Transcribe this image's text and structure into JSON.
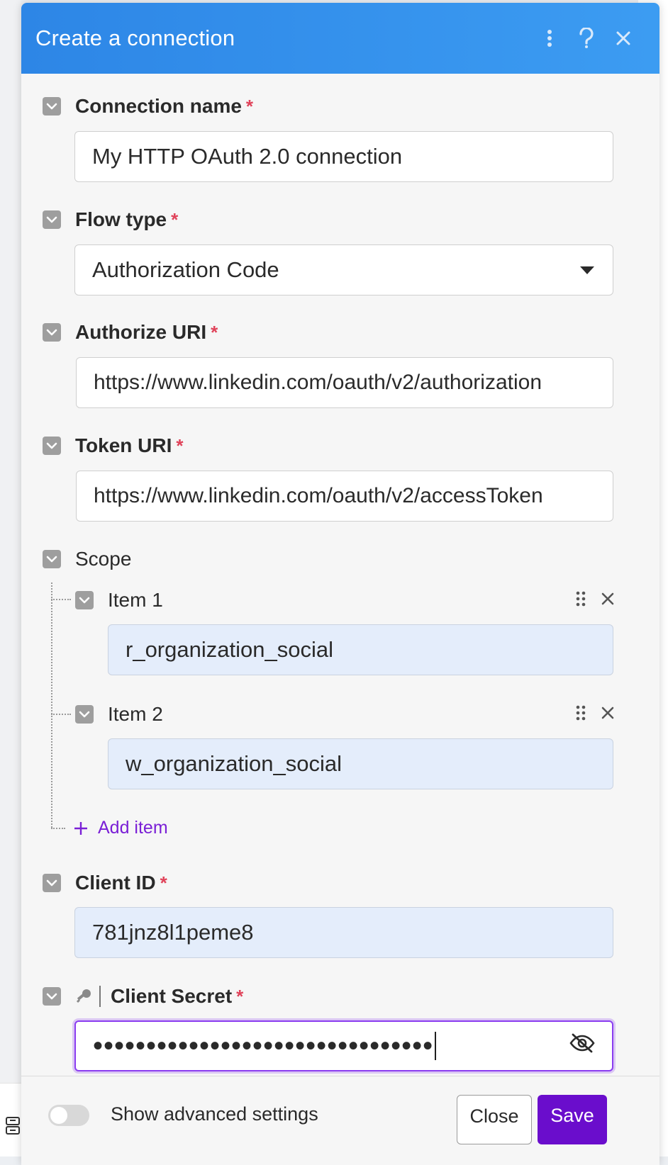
{
  "dialog": {
    "title": "Create a connection",
    "header_icons": [
      "more-vertical-icon",
      "help-icon",
      "close-icon"
    ]
  },
  "fields": {
    "connection_name": {
      "label": "Connection name",
      "required_mark": "*",
      "value": "My HTTP OAuth 2.0 connection"
    },
    "flow_type": {
      "label": "Flow type",
      "required_mark": "*",
      "value": "Authorization Code"
    },
    "authorize_uri": {
      "label": "Authorize URI",
      "required_mark": "*",
      "value": "https://www.linkedin.com/oauth/v2/authorization"
    },
    "token_uri": {
      "label": "Token URI",
      "required_mark": "*",
      "value": "https://www.linkedin.com/oauth/v2/accessToken"
    },
    "scope": {
      "label": "Scope",
      "items": [
        {
          "label": "Item 1",
          "value": "r_organization_social"
        },
        {
          "label": "Item 2",
          "value": "w_organization_social"
        }
      ],
      "add_label": "Add item"
    },
    "client_id": {
      "label": "Client ID",
      "required_mark": "*",
      "value": "781jnz8l1peme8"
    },
    "client_secret": {
      "label": "Client Secret",
      "required_mark": "*",
      "value": "••••••••••••••••••••••••••••••••"
    }
  },
  "footer": {
    "advanced_label": "Show advanced settings",
    "close_label": "Close",
    "save_label": "Save"
  },
  "colors": {
    "header": "#2d86e6",
    "required": "#e0435a",
    "accent_purple": "#6a0dcc",
    "tinted_input": "#e4edfb"
  }
}
